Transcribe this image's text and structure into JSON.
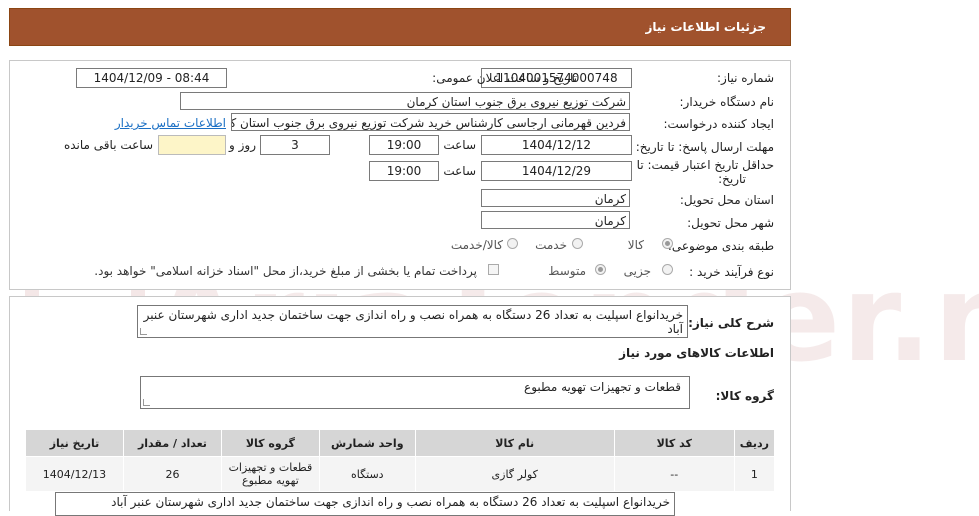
{
  "header": {
    "title": "جزئیات اطلاعات نیاز"
  },
  "fields": {
    "need_number_label": "شماره نیاز:",
    "need_number": "1104001574000748",
    "announce_label": "تاریخ و ساعت اعلان عمومی:",
    "announce_value": "1404/12/09 - 08:44",
    "buyer_label": "نام دستگاه خریدار:",
    "buyer_value": "شرکت توزیع نیروی برق جنوب استان کرمان",
    "creator_label": "ایجاد کننده درخواست:",
    "creator_value": "فردین قهرمانی ارجاسی کارشناس خرید شرکت توزیع نیروی برق جنوب استان کر",
    "contact_link": "اطلاعات تماس خریدار",
    "deadline_label": "مهلت ارسال پاسخ: تا تاریخ:",
    "deadline_date": "1404/12/12",
    "time_label": "ساعت",
    "deadline_time": "19:00",
    "days_value": "3",
    "days_label": "روز و",
    "remaining_label": "ساعت باقی مانده",
    "validity_label_1": "حداقل تاریخ اعتبار قیمت: تا",
    "validity_label_2": "تاریخ:",
    "validity_date": "1404/12/29",
    "validity_time": "19:00",
    "province_label": "استان محل تحویل:",
    "province_value": "کرمان",
    "city_label": "شهر محل تحویل:",
    "city_value": "کرمان",
    "category_label": "طبقه بندی موضوعی:",
    "category_options": [
      "کالا",
      "خدمت",
      "کالا/خدمت"
    ],
    "process_label": "نوع فرآیند خرید :",
    "process_options": [
      "جزیی",
      "متوسط"
    ],
    "payment_note": "پرداخت تمام یا بخشی از مبلغ خرید،از محل \"اسناد خزانه اسلامی\" خواهد بود."
  },
  "description": {
    "label": "شرح کلی نیاز:",
    "text": "خریدانواع اسپلیت به تعداد 26 دستگاه به همراه نصب و راه اندازی جهت ساختمان جدید اداری شهرستان عنبر آباد"
  },
  "goods": {
    "section_title": "اطلاعات کالاهای مورد نیاز",
    "group_label": "گروه کالا:",
    "group_value": "قطعات و تجهیزات تهویه مطبوع",
    "columns": [
      "ردیف",
      "کد کالا",
      "نام کالا",
      "واحد شمارش",
      "گروه کالا",
      "تعداد / مقدار",
      "تاریخ نیاز"
    ],
    "rows": [
      {
        "row": "1",
        "code": "--",
        "name": "کولر گازی",
        "unit": "دستگاه",
        "group": "قطعات و تجهیزات تهویه مطبوع",
        "qty": "26",
        "date": "1404/12/13"
      }
    ],
    "note": "خریدانواع  اسپلیت به تعداد 26 دستگاه به همراه نصب و راه اندازی جهت ساختمان جدید  اداری شهرستان عنبر آباد"
  },
  "watermark": "AriaTender.neT",
  "colors": {
    "header_bg": "#a0522d",
    "link": "#1a6fc4",
    "remaining_box": "#fdf5c8"
  }
}
